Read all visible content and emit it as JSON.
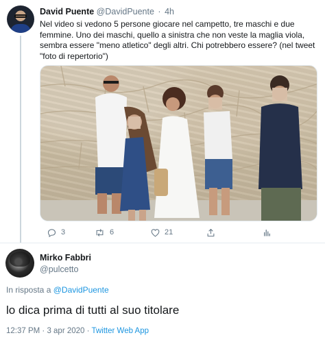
{
  "tweet": {
    "author_name": "David Puente",
    "author_handle": "@DavidPuente",
    "separator": "·",
    "time": "4h",
    "text": "Nel video si vedono 5 persone giocare nel campetto, tre maschi e due femmine. Uno dei maschi, quello a sinistra che non veste la maglia viola, sembra essere \"meno atletico\" degli altri. Chi potrebbero essere? (nel tweet \"foto di repertorio\")",
    "actions": [
      {
        "icon": "reply-icon",
        "count": "3"
      },
      {
        "icon": "retweet-icon",
        "count": "6"
      },
      {
        "icon": "like-icon",
        "count": "21"
      },
      {
        "icon": "share-icon",
        "count": ""
      },
      {
        "icon": "analytics-icon",
        "count": ""
      }
    ]
  },
  "reply": {
    "author_name": "Mirko Fabbri",
    "author_handle": "@pulcetto",
    "reply_prefix": "In risposta a",
    "reply_target": "@DavidPuente",
    "text": "lo dica prima di tutti al suo titolare",
    "timestamp": "12:37 PM · 3 apr 2020",
    "meta_sep": "·",
    "source": "Twitter Web App"
  },
  "colors": {
    "link": "#1b95e0",
    "secondary_text": "#657786",
    "primary_text": "#14171a",
    "divider": "#e6ecf0"
  }
}
